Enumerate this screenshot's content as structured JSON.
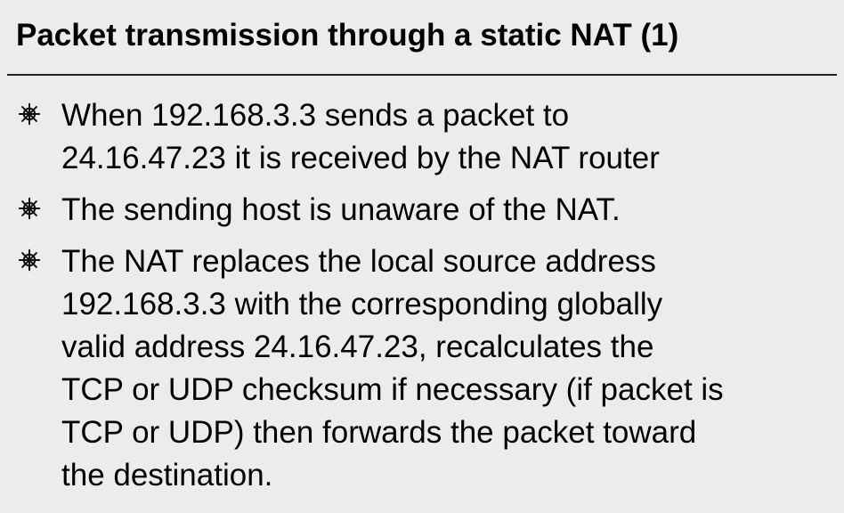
{
  "slide": {
    "title": "Packet transmission through a static NAT (1)",
    "bullet_icon": "ship-wheel-icon",
    "bullets": [
      {
        "text": "When 192.168.3.3 sends a packet to\n24.16.47.23 it is received by the NAT router"
      },
      {
        "text": "The sending host is unaware of the NAT."
      },
      {
        "text": "The NAT replaces the local source address\n192.168.3.3 with the corresponding globally\nvalid address 24.16.47.23, recalculates the\nTCP or UDP checksum if necessary (if packet is\nTCP or UDP) then forwards the packet toward\nthe destination."
      }
    ]
  },
  "colors": {
    "background": "#ececec",
    "text": "#000000",
    "rule": "#222222"
  }
}
